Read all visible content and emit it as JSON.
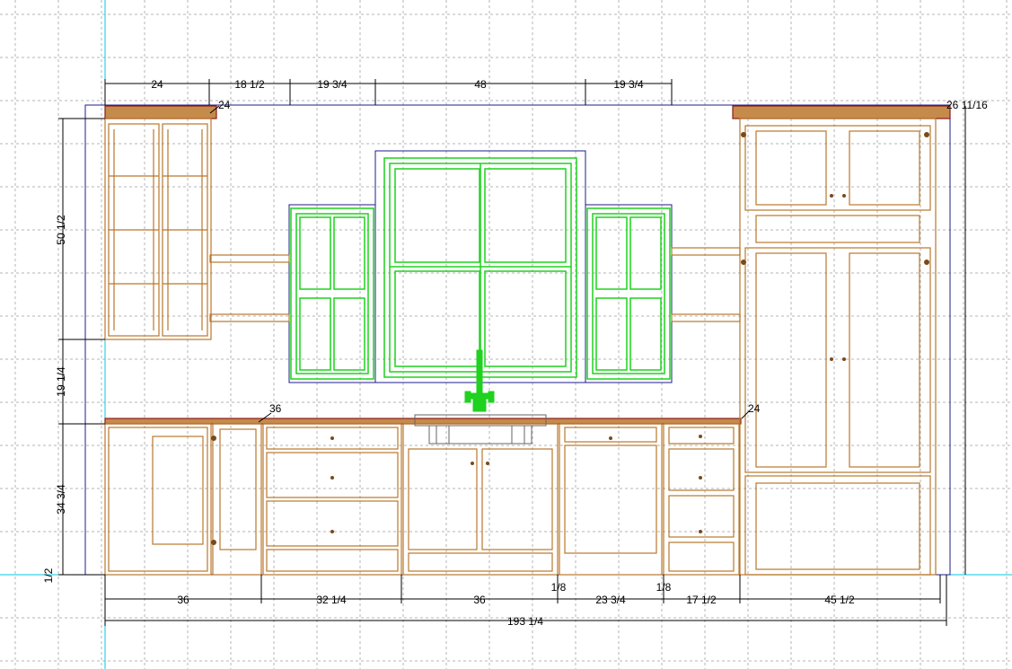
{
  "colors": {
    "grid": "#b4b4b4",
    "guide": "#00c8e6",
    "cabinet": "#b9772c",
    "cabinet_dark": "#7a4a1a",
    "crown": "#8b1a1a",
    "window": "#1ed21e",
    "outline": "#1c1c8c",
    "dimension": "#000000"
  },
  "dimensions": {
    "top": [
      "24",
      "18 1/2",
      "19 3/4",
      "48",
      "19 3/4"
    ],
    "top_right": "26 11/16",
    "cab_depth_upper_left": "24",
    "cab_depth_base_left": "36",
    "cab_depth_base_right": "24",
    "left": [
      "50 1/2",
      "19 1/4",
      "34 3/4",
      "1/2"
    ],
    "bottom": [
      "36",
      "32 1/4",
      "36",
      "1/8",
      "23 3/4",
      "1/8",
      "17 1/2",
      "45 1/2"
    ],
    "overall": "193 1/4"
  },
  "icons": [
    "faucet-icon",
    "sink-icon"
  ]
}
